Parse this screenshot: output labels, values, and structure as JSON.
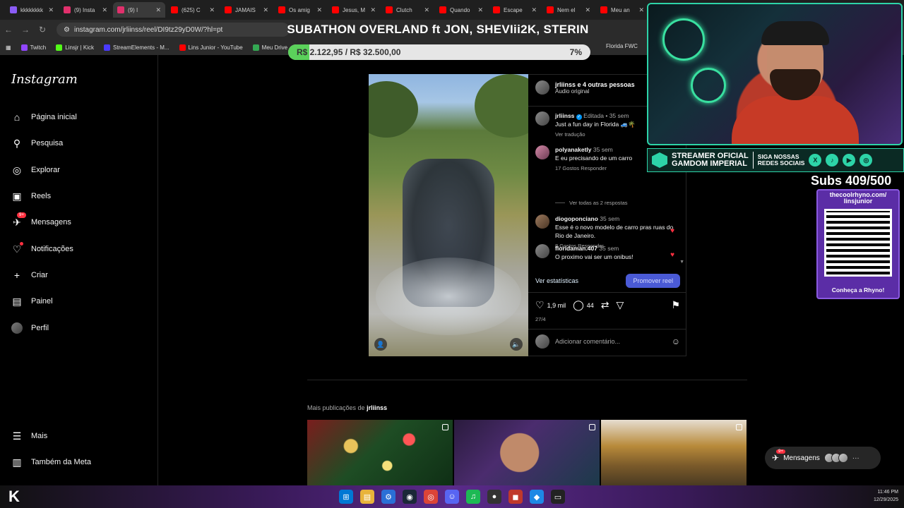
{
  "browser": {
    "tabs": [
      {
        "title": "kkkkkkkk",
        "color": "#8b5cf6",
        "active": false
      },
      {
        "title": "(9) Insta",
        "color": "#e1306c",
        "active": false
      },
      {
        "title": "(9) I",
        "color": "#e1306c",
        "active": true
      },
      {
        "title": "(625) C",
        "color": "#ff0000",
        "active": false
      },
      {
        "title": "JAMAIS",
        "color": "#ff0000",
        "active": false
      },
      {
        "title": "Os amig",
        "color": "#ff0000",
        "active": false
      },
      {
        "title": "Jesus, M",
        "color": "#ff0000",
        "active": false
      },
      {
        "title": "Clutch",
        "color": "#ff0000",
        "active": false
      },
      {
        "title": "Quando",
        "color": "#ff0000",
        "active": false
      },
      {
        "title": "Escape",
        "color": "#ff0000",
        "active": false
      },
      {
        "title": "Nem el",
        "color": "#ff0000",
        "active": false
      },
      {
        "title": "Meu an",
        "color": "#ff0000",
        "active": false
      }
    ],
    "url": "instagram.com/jrliinss/reel/DI9tz29yD0W/?hl=pt",
    "bookmarks": [
      {
        "label": "Twitch",
        "color": "#9146ff"
      },
      {
        "label": "Linsjr | Kick",
        "color": "#53fc18"
      },
      {
        "label": "StreamElements - M...",
        "color": "#4a3aff"
      },
      {
        "label": "Lins Junior - YouTube",
        "color": "#ff0000"
      },
      {
        "label": "Meu Drive",
        "color": "#34a853"
      }
    ],
    "bookmark_right": "Florida FWC"
  },
  "overlay": {
    "title": "SUBATHON OVERLAND ft JON, SHEVIii2K, STERIN",
    "goal_text": "R$ 2.122,95 / R$ 32.500,00",
    "goal_percent_label": "7%",
    "goal_fraction": 0.07,
    "streamer_line1": "STREAMER OFICIAL",
    "streamer_line2": "GAMDOM IMPERIAL",
    "social_line1": "SIGA NOSSAS",
    "social_line2": "REDES SOCIAIS",
    "subs": "Subs 409/500",
    "qr_url": "thecoolrhyno.com/ linsjunior",
    "qr_cta": "Conheça a Rhyno!"
  },
  "instagram": {
    "logo": "Instagram",
    "nav": [
      {
        "label": "Página inicial",
        "icon": "home-icon",
        "glyph": "⌂"
      },
      {
        "label": "Pesquisa",
        "icon": "search-icon",
        "glyph": "⚲"
      },
      {
        "label": "Explorar",
        "icon": "compass-icon",
        "glyph": "◎"
      },
      {
        "label": "Reels",
        "icon": "reels-icon",
        "glyph": "▣"
      },
      {
        "label": "Mensagens",
        "icon": "messenger-icon",
        "glyph": "✈",
        "badge": "9+"
      },
      {
        "label": "Notificações",
        "icon": "heart-icon",
        "glyph": "♡"
      },
      {
        "label": "Criar",
        "icon": "plus-icon",
        "glyph": "+"
      },
      {
        "label": "Painel",
        "icon": "dashboard-icon",
        "glyph": "▤"
      },
      {
        "label": "Perfil",
        "icon": "profile-icon",
        "glyph": ""
      }
    ],
    "more": "Mais",
    "meta": "Também da Meta",
    "post": {
      "header_user": "jrliinss",
      "header_others": "e 4 outras pessoas",
      "audio": "Áudio original",
      "caption_user": "jrliinss",
      "caption_edited": "Editada •",
      "caption_time": "35 sem",
      "caption_text": "Just a fun day in Florida 🚙🌴",
      "translate": "Ver tradução",
      "comments": [
        {
          "user": "polyanaketly",
          "time": "35 sem",
          "text": "E eu precisando de um carro",
          "meta": "17 Gostos   Responder"
        },
        {
          "user": "diogoponciano",
          "time": "35 sem",
          "text": "Esse é o novo modelo de carro pras ruas do Rio de Janeiro.",
          "meta": "8 Gostos   Responder"
        },
        {
          "user": "floridaman.407",
          "time": "35 sem",
          "text": "O proximo vai ser um onibus!",
          "meta": ""
        }
      ],
      "view_all": "Ver todas as 2 respostas",
      "stats_link": "Ver estatísticas",
      "promote": "Promover reel",
      "likes": "1,9 mil",
      "comments_count": "44",
      "date": "27/4",
      "add_comment": "Adicionar comentário..."
    },
    "more_posts_prefix": "Mais publicações de",
    "more_posts_user": "jrliinss",
    "messages_pill": "Mensagens",
    "messages_badge": "9+"
  },
  "taskbar": {
    "logo": "K",
    "clock_time": "11:46 PM",
    "clock_date": "12/29/2025"
  }
}
